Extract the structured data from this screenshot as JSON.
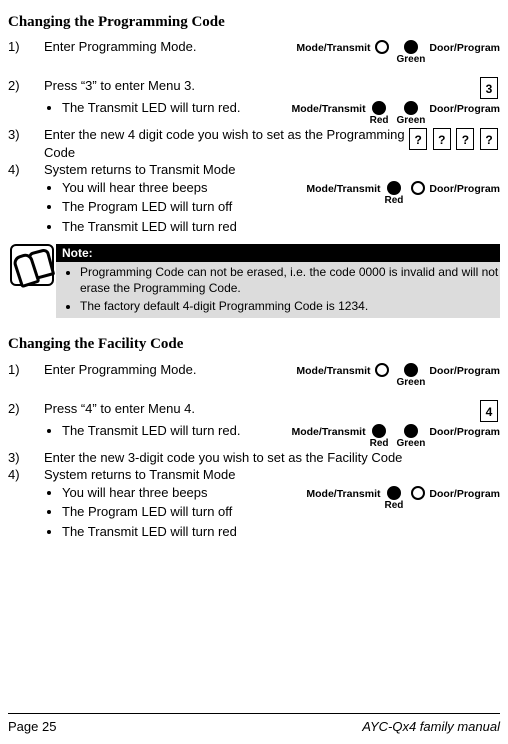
{
  "section1": {
    "heading": "Changing the Programming Code",
    "step1_num": "1)",
    "step1_text": "Enter Programming Mode.",
    "step2_num": "2)",
    "step2_text": "Press “3” to enter Menu 3.",
    "step2_key": "3",
    "step2_b1": "The Transmit LED will turn red.",
    "step3_num": "3)",
    "step3_text": "Enter the new 4 digit code you wish to set as the Programming Code",
    "step3_k1": "?",
    "step3_k2": "?",
    "step3_k3": "?",
    "step3_k4": "?",
    "step4_num": "4)",
    "step4_text": "System returns to Transmit Mode",
    "step4_b1": "You will hear three beeps",
    "step4_b2": "The Program LED will turn off",
    "step4_b3": "The Transmit LED will turn red"
  },
  "note": {
    "title": "Note:",
    "item1": "Programming Code can not be erased, i.e. the code 0000 is invalid and will not erase the Programming Code.",
    "item2": "The factory default 4-digit Programming Code is 1234."
  },
  "section2": {
    "heading": "Changing the Facility Code",
    "step1_num": "1)",
    "step1_text": "Enter Programming Mode.",
    "step2_num": "2)",
    "step2_text": "Press “4” to enter Menu 4.",
    "step2_key": "4",
    "step2_b1": "The Transmit LED will turn red.",
    "step3_num": "3)",
    "step3_text": "Enter the new 3-digit code you wish to set as the Facility Code",
    "step4_num": "4)",
    "step4_text": "System returns to Transmit Mode",
    "step4_b1": "You will hear three beeps",
    "step4_b2": "The Program LED will turn off",
    "step4_b3": "The Transmit LED will turn red"
  },
  "labels": {
    "mode_transmit": "Mode/Transmit",
    "door_program": "Door/Program",
    "red": "Red",
    "green": "Green"
  },
  "footer": {
    "left": "Page 25",
    "right": "AYC-Qx4 family manual"
  }
}
